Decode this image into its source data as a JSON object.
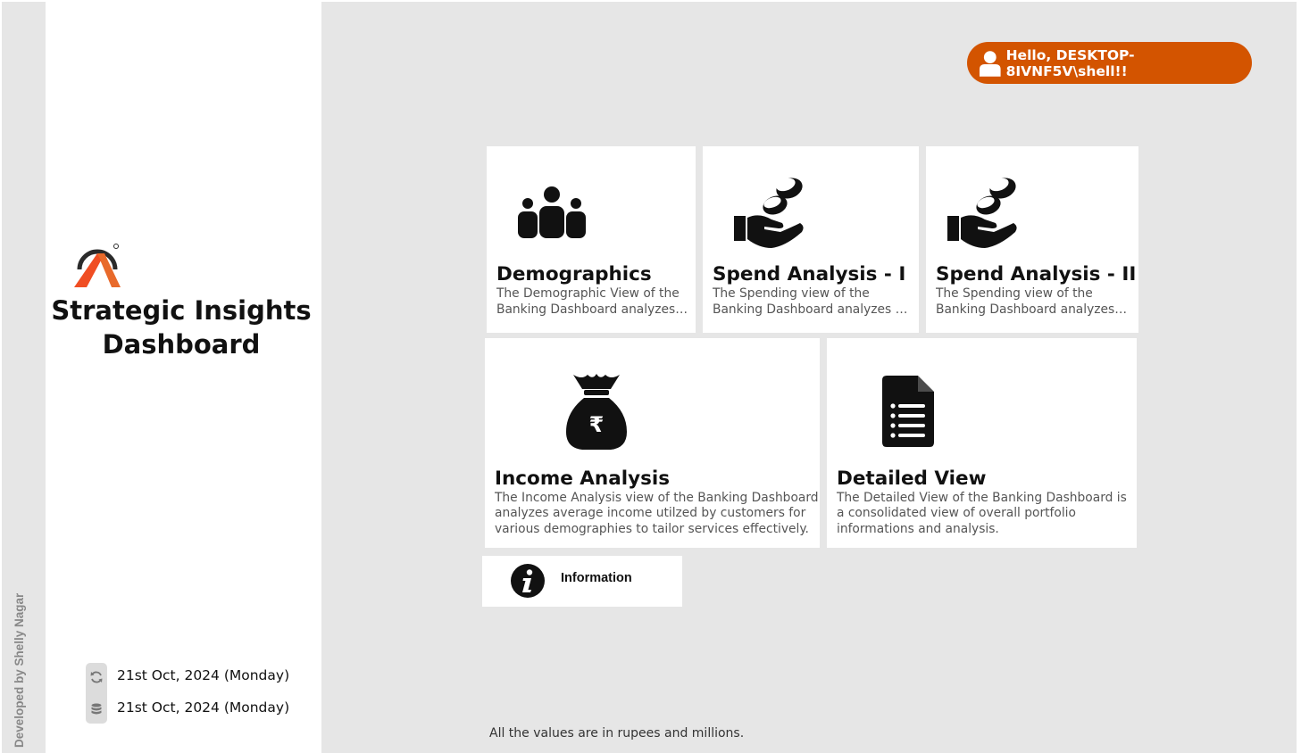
{
  "sidebar": {
    "title": "Strategic Insights Dashboard",
    "credit": "Developed by Shelly Nagar",
    "logo_icon": "app-logo-icon",
    "refresh_date": "21st Oct, 2024 (Monday)",
    "data_date": "21st Oct, 2024 (Monday)"
  },
  "header": {
    "greeting": "Hello, DESKTOP-8IVNF5V\\shell!!",
    "accent_color": "#d35400"
  },
  "cards": {
    "demographics": {
      "title": "Demographics",
      "desc_line1": "The Demographic View of the",
      "desc_line2": "Banking Dashboard analyzes c..",
      "icon": "people-group-icon"
    },
    "spend1": {
      "title": "Spend Analysis - I",
      "desc_line1": "The Spending view of the",
      "desc_line2": "Banking Dashboard analyzes av..",
      "icon": "hand-coins-icon"
    },
    "spend2": {
      "title": "Spend Analysis - II",
      "desc_line1": "The Spending view of the",
      "desc_line2": "Banking Dashboard analyzes a..",
      "icon": "hand-coins-icon"
    },
    "income": {
      "title": "Income Analysis",
      "desc_line1": "The Income Analysis view of the Banking Dashboard",
      "desc_line2": "analyzes average income utilzed by customers for",
      "desc_line3": "various demographies to tailor services effectively.",
      "icon": "rupee-money-bag-icon"
    },
    "detailed": {
      "title": "Detailed View",
      "desc_line1": "The Detailed View of the Banking Dashboard is",
      "desc_line2": "a consolidated view of overall portfolio",
      "desc_line3": "informations and analysis.",
      "icon": "document-list-icon"
    },
    "information": {
      "label": "Information",
      "icon": "info-icon"
    }
  },
  "footer": {
    "note": "All the values are in rupees and millions."
  }
}
